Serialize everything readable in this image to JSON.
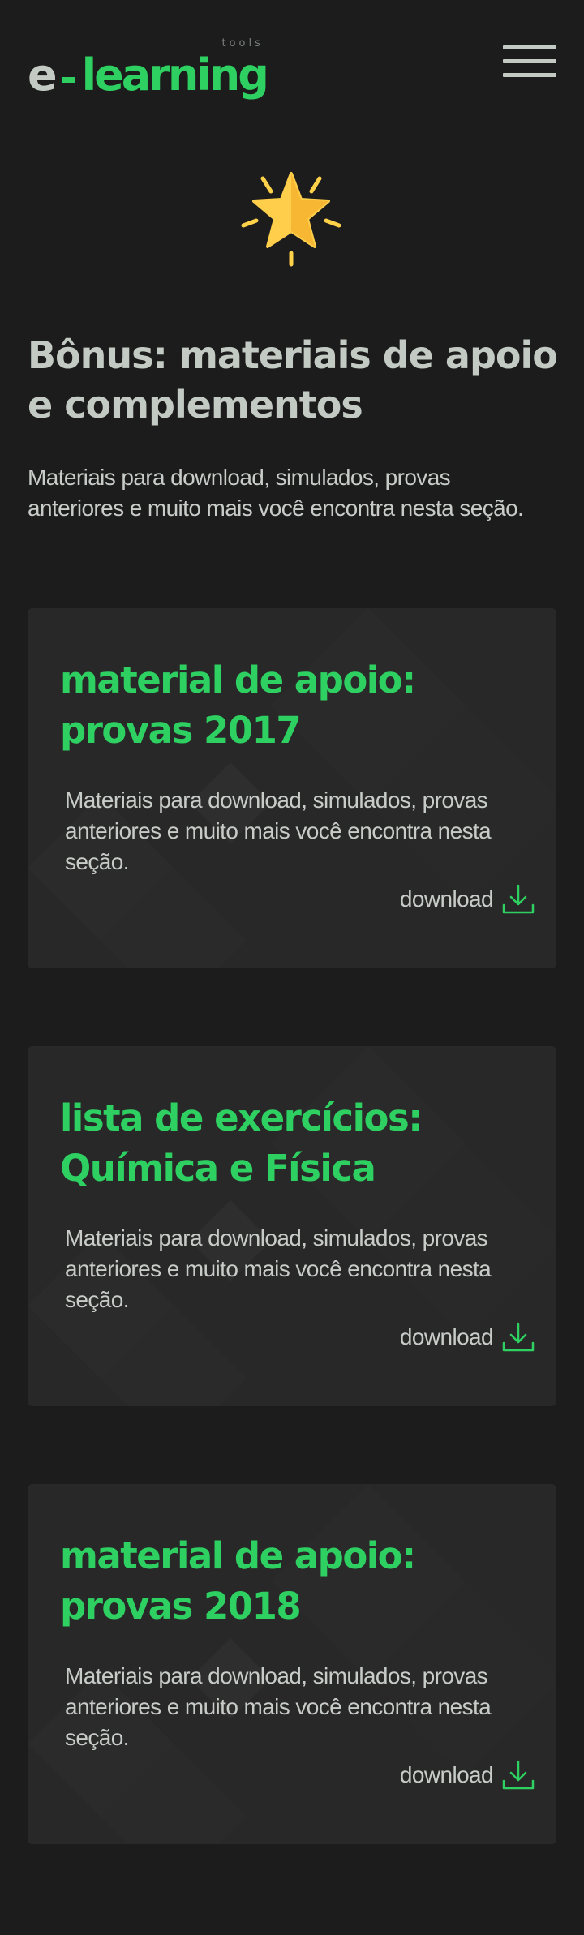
{
  "header": {
    "logo": {
      "e": "e",
      "word": "learning",
      "tools": "tools"
    }
  },
  "hero": {
    "icon": "star-icon",
    "title": "Bônus: materiais de apoio e complementos",
    "description": "Materiais para download, simulados, provas anteriores e muito mais você encontra nesta seção."
  },
  "cards": [
    {
      "title": "material de apoio: provas 2017",
      "description": "Materiais para download, simulados, provas anteriores e muito mais você encontra nesta seção.",
      "download_label": "download"
    },
    {
      "title": "lista de exercícios: Química e Física",
      "description": "Materiais para download, simulados, provas anteriores e muito mais você encontra nesta seção.",
      "download_label": "download"
    },
    {
      "title": "material de apoio: provas 2018",
      "description": "Materiais para download, simulados, provas anteriores e muito mais você encontra nesta seção.",
      "download_label": "download"
    }
  ],
  "colors": {
    "background": "#1c1c1c",
    "card": "#282828",
    "accent": "#2ed062",
    "text": "#c3cac3"
  }
}
